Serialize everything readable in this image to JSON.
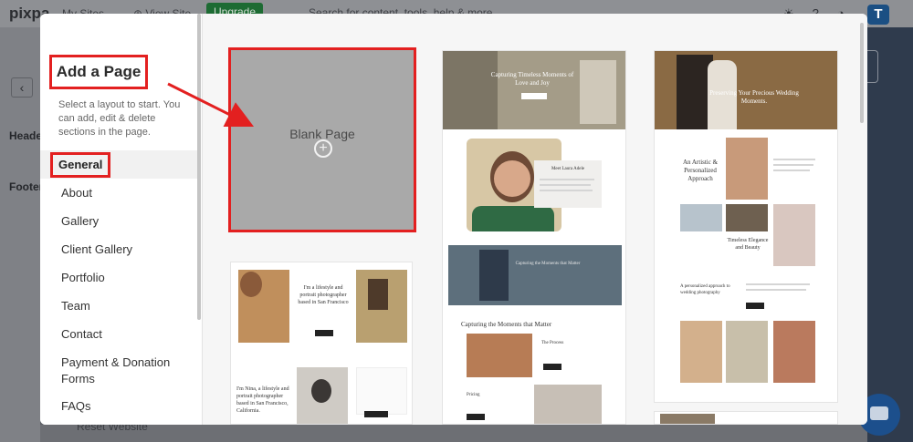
{
  "app": {
    "brand": "pixpa",
    "nav": [
      "My Sites ⌄",
      "⊕ View Site"
    ],
    "upgrade_label": "Upgrade",
    "search_placeholder": "Search for content, tools, help & more...",
    "avatar_letter": "T",
    "left_labels": [
      "Heade",
      "Footer"
    ],
    "reset_label": "Reset Website"
  },
  "modal": {
    "title": "Add a Page",
    "description": "Select a layout to start. You can add, edit & delete sections in the page.",
    "categories": [
      "General",
      "About",
      "Gallery",
      "Client Gallery",
      "Portfolio",
      "Team",
      "Contact",
      "Payment & Donation Forms",
      "FAQs"
    ],
    "active_category": "General"
  },
  "templates": {
    "blank": {
      "label": "Blank Page",
      "icon": "plus-circle-icon"
    },
    "t1": {
      "text_a": "I'm a lifestyle and portrait photographer based in San Francisco",
      "text_b": "I'm Nina, a lifestyle and portrait photographer based in San Francisco, California."
    },
    "t2": {
      "hero": "Capturing Timeless Moments of Love and Joy",
      "about": "Meet Laura Adele",
      "band": "Capturing the Moments that Matter",
      "heading": "Capturing the Moments that Matter",
      "p1": "The Process",
      "p2": "Pricing"
    },
    "t3": {
      "hero": "Preserving Your Precious Wedding Moments.",
      "h1": "An Artistic & Personalized Approach",
      "h2": "Timeless Elegance and Beauty",
      "h3": "A personalized approach to wedding photography"
    }
  },
  "colors": {
    "accent": "#e32020",
    "upgrade": "#1d6b33",
    "brand_blue": "#1b4f83"
  }
}
